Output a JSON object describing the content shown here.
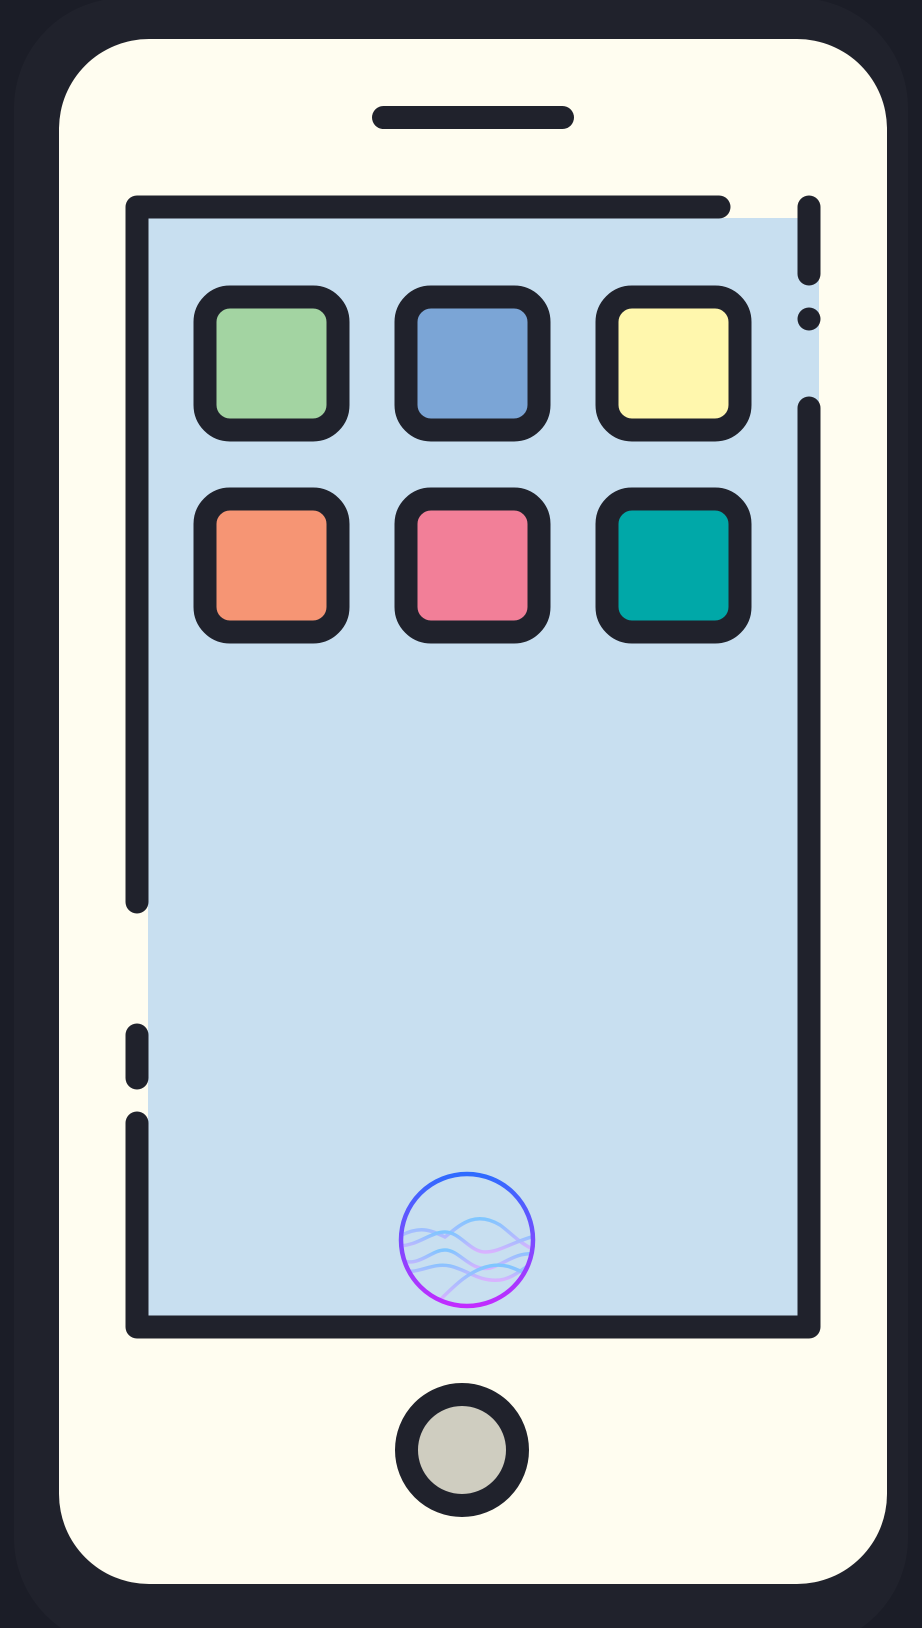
{
  "colors": {
    "background": "#1b1d27",
    "phone_body": "#20222c",
    "phone_face": "#fffdf0",
    "screen": "#c8dff0",
    "outline": "#20222c",
    "home_button_fill": "#cfcdc0",
    "siri_gradient_top": "#2f6bff",
    "siri_gradient_bottom": "#c22cff"
  },
  "app_icons": [
    {
      "name": "app-icon-green",
      "color": "#a3d4a2"
    },
    {
      "name": "app-icon-blue",
      "color": "#7ba5d6"
    },
    {
      "name": "app-icon-yellow",
      "color": "#fff7ad"
    },
    {
      "name": "app-icon-orange",
      "color": "#f69574"
    },
    {
      "name": "app-icon-pink",
      "color": "#f27f98"
    },
    {
      "name": "app-icon-teal",
      "color": "#00a8a8"
    }
  ],
  "siri_icon": "siri-wave-icon",
  "home_button_icon": "home-button-icon"
}
